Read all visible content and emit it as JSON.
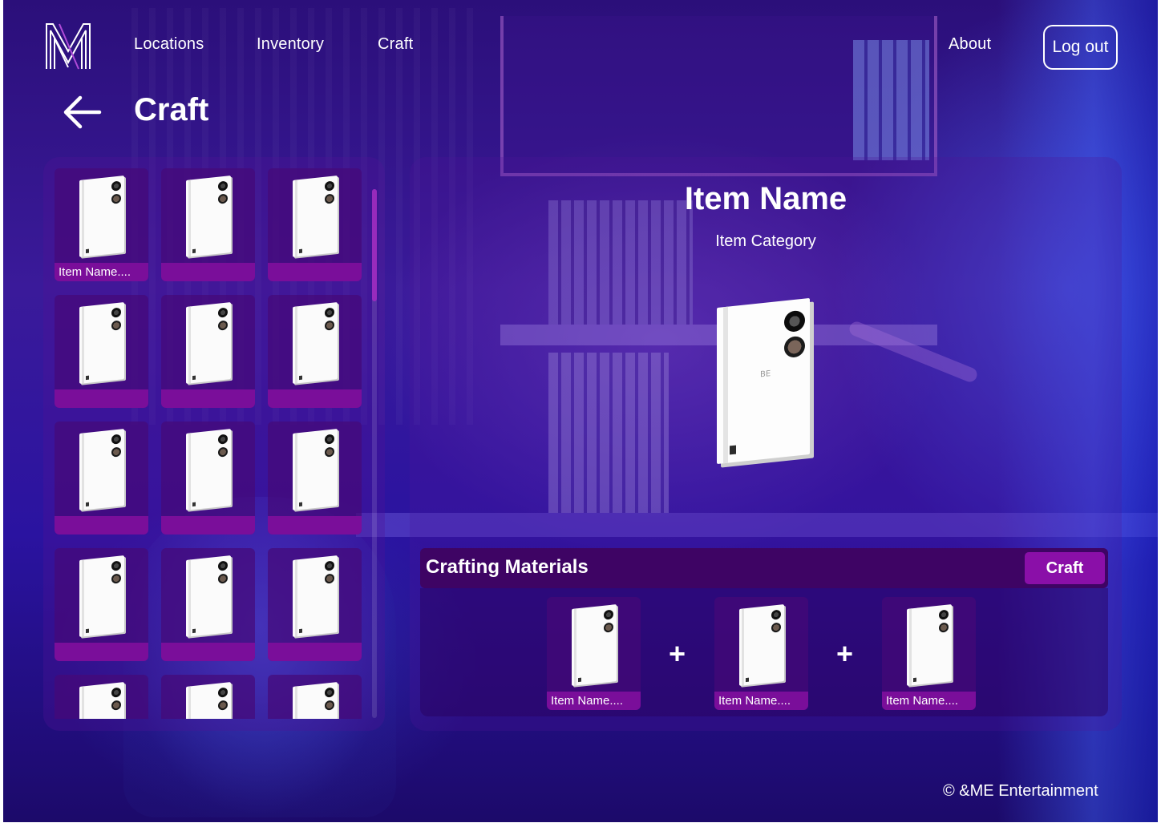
{
  "nav": {
    "locations": "Locations",
    "inventory": "Inventory",
    "craft": "Craft",
    "about": "About",
    "logout": "Log out"
  },
  "page": {
    "title": "Craft"
  },
  "grid": {
    "items": [
      {
        "label": "Item Name...."
      },
      {
        "label": ""
      },
      {
        "label": ""
      },
      {
        "label": ""
      },
      {
        "label": ""
      },
      {
        "label": ""
      },
      {
        "label": ""
      },
      {
        "label": ""
      },
      {
        "label": ""
      },
      {
        "label": ""
      },
      {
        "label": ""
      },
      {
        "label": ""
      },
      {
        "label": ""
      },
      {
        "label": ""
      },
      {
        "label": ""
      }
    ]
  },
  "detail": {
    "name": "Item Name",
    "category": "Item Category"
  },
  "materials": {
    "title": "Crafting Materials",
    "craft_label": "Craft",
    "plus": "+",
    "items": [
      {
        "label": "Item Name...."
      },
      {
        "label": "Item Name...."
      },
      {
        "label": "Item Name...."
      }
    ]
  },
  "footer": {
    "copyright": "© &ME Entertainment"
  },
  "colors": {
    "accent": "#7a0e9a",
    "craft_button": "#8a0fa8",
    "materials_bar": "#3e0464"
  },
  "icons": {
    "logo": "m-logo-icon",
    "back": "arrow-left-icon",
    "item": "album-icon"
  }
}
